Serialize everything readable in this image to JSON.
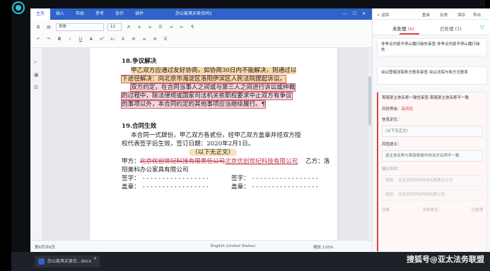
{
  "ribbon": {
    "tabs": [
      "主页",
      "插入",
      "布局",
      "参考",
      "协作",
      "插件"
    ],
    "doc_title": "办公家具买卖合同1",
    "window_icons": "— ☐ ✕"
  },
  "toolbar": {
    "font_name": "宋体",
    "font_size": "12",
    "format_buttons": [
      "B",
      "I",
      "U",
      "S",
      "x²",
      "x₂",
      "A"
    ]
  },
  "document": {
    "section18_title": "18.争议解决",
    "line1": "甲乙双方应通过友好协商，如协商30日内不能解决，则通过以",
    "line2": "下途径解决：向北京市海淀区洛阳伊滨区人民法院提起诉讼。",
    "line3": "双方约定，在合同当事人之间或与第三人之间进行诉讼或仲裁",
    "line4": "的过程中，除法律规或国家司法机关依职权要求中止双方有争议",
    "line5": "的事项以外，本合同约定的其他事项应当继续履行。¶",
    "section19_title": "19.合同生效",
    "line6": "本合同一式肆份，甲乙双方各贰份，经甲乙双方盖章并经双方授",
    "line7": "权代表签字后生效，签订日期：2020年2月1日。",
    "no_text": "（以下无正文）",
    "party_a_label": "甲方：",
    "party_a_deleted": "北京优创世纪科技有限责任公司",
    "party_a_inserted": "北京优创世纪科技有限公司",
    "party_b_label": "乙方：洛",
    "party_b_cont": "阳美科办公家具有限公司",
    "sign_label": "签字：",
    "stamp_label": "盖章：",
    "dashes": "- - - - - - - - - - - - - - - - -"
  },
  "statusbar": {
    "page_info": "第6页共6页",
    "language": "English (United States)",
    "zoom": "横放 120%"
  },
  "panel": {
    "back_label": "< 返回",
    "actions": [
      "重审",
      "反馈",
      "保存",
      "导出"
    ],
    "tab_pending": "未处理",
    "tab_pending_count": "(6)",
    "tab_done": "已处理",
    "tab_done_count": "(1)",
    "card1": "非争议内容不停止履行缺失审查-非争议内容不停止履行缺失",
    "card2": "诉讼管辖法院条方联系审查-诉讼法院与条方无联系",
    "card3": "首尾部主体名称一致性审查-首尾部主体名称不一致",
    "risk_label": "风险等级：",
    "risk_value": "高风险",
    "info_label": "信息定位：",
    "info_value": "(以下无正文)",
    "hint_label": "风险提示：",
    "hint_value": "该主体名称与首部条款中的法方名称不一致",
    "suggest_label": "建议修改：",
    "suggest_row1_label": "首部：",
    "suggest_row1_value": "北京优创世纪科技有限责任公司",
    "suggest_row2_label": "尾部：",
    "suggest_row2_value": "北京优创世纪科技有限公司",
    "footer_left": "忽略",
    "footer_mid": "添加批注",
    "footer_right": "已处理"
  },
  "taskbar": {
    "app_label": "办公家具买卖合...docx",
    "more": "∧"
  },
  "watermark": "搜狐号@亚太法务联盟"
}
